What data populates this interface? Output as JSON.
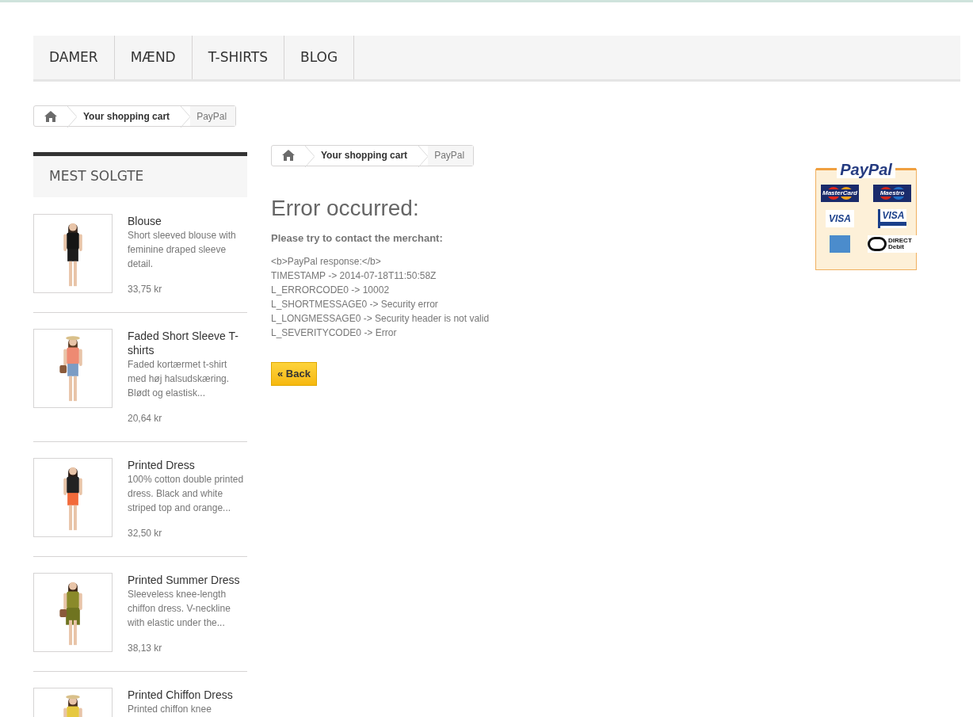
{
  "nav": [
    "DAMER",
    "MÆND",
    "T-SHIRTS",
    "BLOG"
  ],
  "breadcrumb_top": [
    "Your shopping cart",
    "PayPal"
  ],
  "sidebar": {
    "title": "MEST SOLGTE",
    "products": [
      {
        "name": "Blouse",
        "description": "Short sleeved blouse with feminine draped sleeve detail.",
        "price": "33,75 kr"
      },
      {
        "name": "Faded Short Sleeve T-shirts",
        "description": "Faded kortærmet t-shirt med høj halsudskæring. Blødt og elastisk...",
        "price": "20,64 kr"
      },
      {
        "name": "Printed Dress",
        "description": "100% cotton double printed dress. Black and white striped top and orange...",
        "price": "32,50 kr"
      },
      {
        "name": "Printed Summer Dress",
        "description": "Sleeveless knee-length chiffon dress. V-neckline with elastic under the...",
        "price": "38,13 kr"
      },
      {
        "name": "Printed Chiffon Dress",
        "description": "Printed chiffon knee"
      }
    ]
  },
  "breadcrumb_main": [
    "Your shopping cart",
    "PayPal"
  ],
  "error": {
    "title": "Error occurred:",
    "subtitle": "Please try to contact the merchant:",
    "lines": [
      "<b>PayPal response:</b>",
      "TIMESTAMP -> 2014-07-18T11:50:58Z",
      "L_ERRORCODE0 -> 10002",
      "L_SHORTMESSAGE0 -> Security error",
      "L_LONGMESSAGE0 -> Security header is not valid",
      "L_SEVERITYCODE0 -> Error"
    ],
    "back_button": "« Back"
  },
  "paypal_badge": {
    "title": "PayPal",
    "cards": [
      {
        "kind": "mastercard",
        "label": "MasterCard"
      },
      {
        "kind": "maestro",
        "label": "Maestro"
      },
      {
        "kind": "visa",
        "label": "VISA"
      },
      {
        "kind": "visa_electron",
        "label": "VISA"
      },
      {
        "kind": "amex"
      },
      {
        "kind": "direct_debit",
        "label": "DIRECT Debit"
      }
    ]
  }
}
